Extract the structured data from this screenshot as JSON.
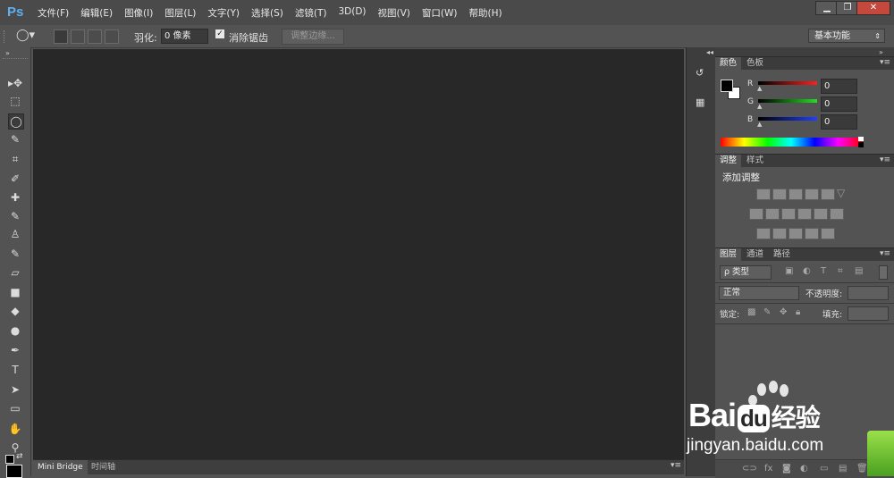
{
  "app": {
    "logo": "Ps"
  },
  "menubar": {
    "items": [
      "文件(F)",
      "编辑(E)",
      "图像(I)",
      "图层(L)",
      "文字(Y)",
      "选择(S)",
      "滤镜(T)",
      "3D(D)",
      "视图(V)",
      "窗口(W)",
      "帮助(H)"
    ]
  },
  "window_controls": {
    "minimize": "▁",
    "restore": "❐",
    "close": "✕"
  },
  "options": {
    "feather_label": "羽化:",
    "feather_value": "0 像素",
    "antialias_label": "消除锯齿",
    "antialias_checked": true,
    "refine_edge_label": "调整边缘...",
    "workspace": "基本功能"
  },
  "tools": [
    "move-icon",
    "marquee-icon",
    "lasso-icon",
    "quick-select-icon",
    "crop-icon",
    "eyedropper-icon",
    "healing-brush-icon",
    "brush-icon",
    "stamp-icon",
    "history-brush-icon",
    "eraser-icon",
    "gradient-icon",
    "blur-icon",
    "dodge-icon",
    "pen-icon",
    "type-icon",
    "path-select-icon",
    "rectangle-icon",
    "hand-icon",
    "zoom-icon"
  ],
  "tool_glyphs": [
    "▸✥",
    "⬚",
    "◯",
    "✎",
    "⌗",
    "✐",
    "✚",
    "✎",
    "♙",
    "✎",
    "▱",
    "■",
    "◆",
    "●",
    "✒",
    "T",
    "➤",
    "▭",
    "✋",
    "⚲"
  ],
  "bottom_tabs": [
    "Mini Bridge",
    "时间轴"
  ],
  "color_panel": {
    "tabs": [
      "颜色",
      "色板"
    ],
    "channels": [
      {
        "label": "R",
        "value": "0",
        "color": "#d42020"
      },
      {
        "label": "G",
        "value": "0",
        "color": "#20b020"
      },
      {
        "label": "B",
        "value": "0",
        "color": "#2030d0"
      }
    ]
  },
  "adjustments_panel": {
    "tabs": [
      "调整",
      "样式"
    ],
    "title": "添加调整"
  },
  "layers_panel": {
    "tabs": [
      "图层",
      "通道",
      "路径"
    ],
    "filter_kind": "ρ 类型",
    "blend_mode": "正常",
    "opacity_label": "不透明度:",
    "lock_label": "锁定:",
    "fill_label": "填充:"
  },
  "watermark": {
    "brand": "Bai",
    "brand2": "du",
    "brand_cn": "经验",
    "url": "jingyan.baidu.com"
  }
}
